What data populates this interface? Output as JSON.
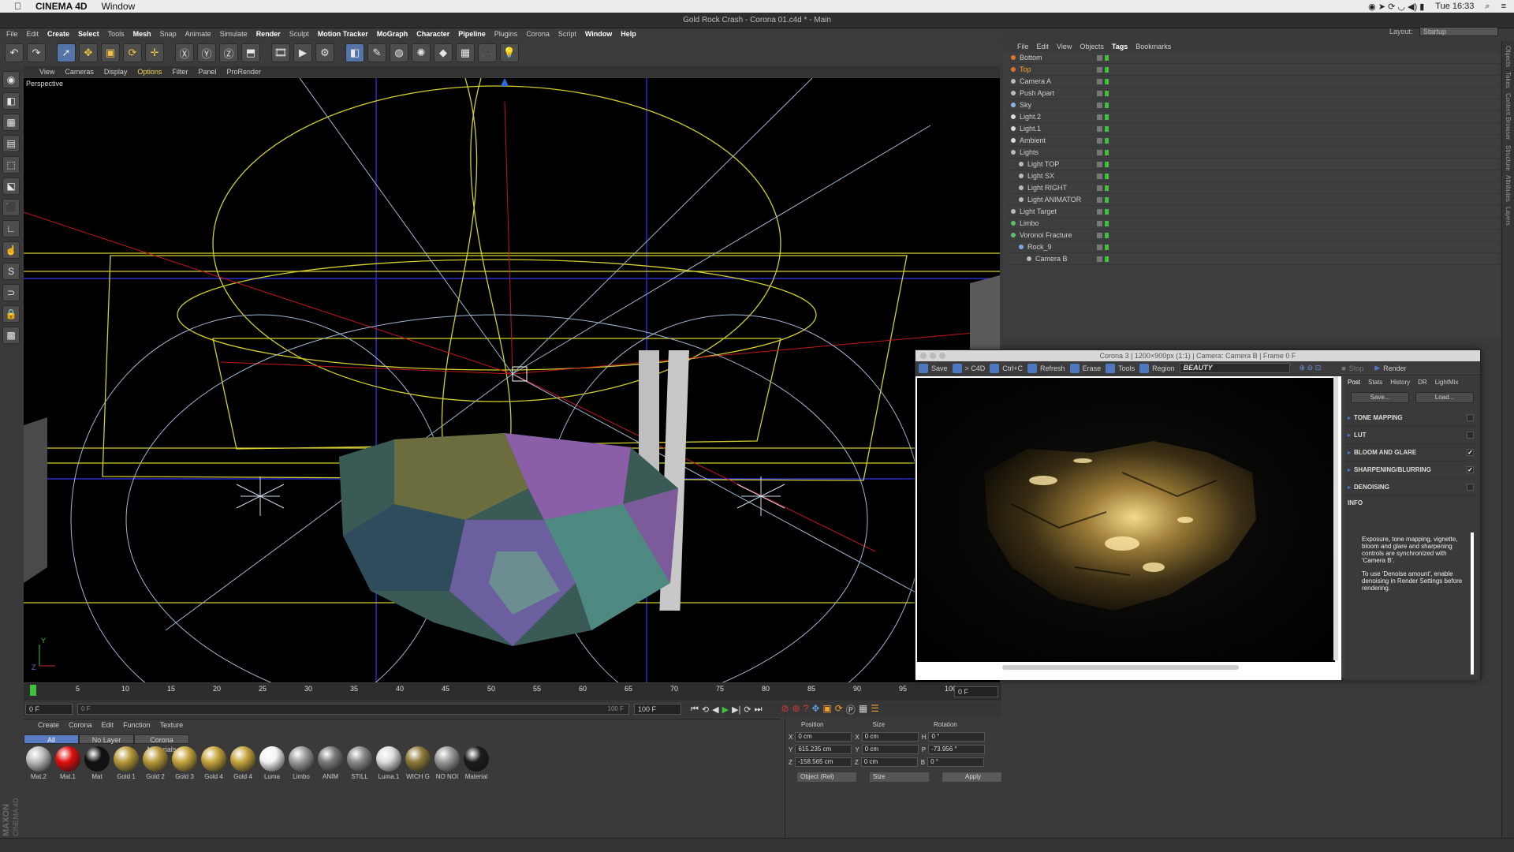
{
  "mac_menubar": {
    "app_name": "CINEMA 4D",
    "window_menu": "Window",
    "time": "Tue 16:33"
  },
  "window_title": "Gold Rock Crash - Corona 01.c4d * - Main",
  "main_menu": [
    "File",
    "Edit",
    "Create",
    "Select",
    "Tools",
    "Mesh",
    "Snap",
    "Animate",
    "Simulate",
    "Render",
    "Sculpt",
    "Motion Tracker",
    "MoGraph",
    "Character",
    "Pipeline",
    "Plugins",
    "Corona",
    "Script",
    "Window",
    "Help"
  ],
  "main_menu_highlight": [
    "Create",
    "Select",
    "Mesh",
    "Render",
    "Motion Tracker",
    "MoGraph",
    "Character",
    "Pipeline",
    "Window",
    "Help"
  ],
  "layout": {
    "label": "Layout:",
    "value": "Startup"
  },
  "viewport": {
    "menu": [
      "View",
      "Cameras",
      "Display",
      "Options",
      "Filter",
      "Panel",
      "ProRender"
    ],
    "active_menu": "Options",
    "label": "Perspective"
  },
  "timeline": {
    "ticks": [
      "0",
      "5",
      "10",
      "15",
      "20",
      "25",
      "30",
      "35",
      "40",
      "45",
      "50",
      "55",
      "60",
      "65",
      "70",
      "75",
      "80",
      "85",
      "90",
      "95",
      "100"
    ],
    "current_frame": "0 F",
    "start": "0 F",
    "slider_start": "0 F",
    "slider_end": "100 F",
    "end": "100 F"
  },
  "materials": {
    "menu": [
      "Create",
      "Corona",
      "Edit",
      "Function",
      "Texture"
    ],
    "tabs": [
      "All",
      "No Layer",
      "Corona Materials"
    ],
    "items": [
      {
        "name": "Mat.2",
        "color": "#bdbdbd"
      },
      {
        "name": "Mat.1",
        "color": "#e01010"
      },
      {
        "name": "Mat",
        "color": "#111111"
      },
      {
        "name": "Gold 1",
        "color": "#b89a3a"
      },
      {
        "name": "Gold 2",
        "color": "#b89a3a"
      },
      {
        "name": "Gold 3",
        "color": "#c7a53d"
      },
      {
        "name": "Gold 4",
        "color": "#c7a53d"
      },
      {
        "name": "Gold 4",
        "color": "#c7a53d"
      },
      {
        "name": "Luma",
        "color": "#f4f4f4"
      },
      {
        "name": "Limbo",
        "color": "#9c9c9c"
      },
      {
        "name": "ANIM",
        "color": "#7a7a7a"
      },
      {
        "name": "STILL",
        "color": "#8a8a8a"
      },
      {
        "name": "Luma.1",
        "color": "#dddddd"
      },
      {
        "name": "WICH G",
        "color": "#8e7a3a"
      },
      {
        "name": "NO NOI",
        "color": "#9a9a9a"
      },
      {
        "name": "Material",
        "color": "#1c1c1c"
      }
    ]
  },
  "coordinates": {
    "headers": [
      "Position",
      "Size",
      "Rotation"
    ],
    "rows": [
      {
        "axis": "X",
        "pos": "0 cm",
        "saxis": "X",
        "size": "0 cm",
        "raxis": "H",
        "rot": "0 °"
      },
      {
        "axis": "Y",
        "pos": "615.235 cm",
        "saxis": "Y",
        "size": "0 cm",
        "raxis": "P",
        "rot": "-73.956 °"
      },
      {
        "axis": "Z",
        "pos": "-158.565 cm",
        "saxis": "Z",
        "size": "0 cm",
        "raxis": "B",
        "rot": "0 °"
      }
    ],
    "mode": "Object (Rel)",
    "size_mode": "Size",
    "apply": "Apply"
  },
  "object_manager": {
    "menu": [
      "File",
      "Edit",
      "View",
      "Objects",
      "Tags",
      "Bookmarks"
    ],
    "active_menu": "Tags",
    "objects": [
      {
        "name": "Bottom",
        "indent": 0,
        "color": "#e0762b",
        "name_color": "#cfcfcf"
      },
      {
        "name": "Top",
        "indent": 0,
        "color": "#e0762b",
        "name_color": "#f0a030"
      },
      {
        "name": "Camera A",
        "indent": 0,
        "color": "#bbbbbb",
        "name_color": "#cfcfcf"
      },
      {
        "name": "Push Apart",
        "indent": 0,
        "color": "#bbbbbb",
        "name_color": "#cfcfcf"
      },
      {
        "name": "Sky",
        "indent": 0,
        "color": "#8fb4e0",
        "name_color": "#cfcfcf"
      },
      {
        "name": "Light.2",
        "indent": 0,
        "color": "#dddddd",
        "name_color": "#cfcfcf"
      },
      {
        "name": "Light.1",
        "indent": 0,
        "color": "#dddddd",
        "name_color": "#cfcfcf"
      },
      {
        "name": "Ambient",
        "indent": 0,
        "color": "#dddddd",
        "name_color": "#cfcfcf"
      },
      {
        "name": "Lights",
        "indent": 0,
        "color": "#bbbbbb",
        "name_color": "#cfcfcf"
      },
      {
        "name": "Light TOP",
        "indent": 1,
        "color": "#bbbbbb",
        "name_color": "#cfcfcf"
      },
      {
        "name": "Light SX",
        "indent": 1,
        "color": "#bbbbbb",
        "name_color": "#cfcfcf"
      },
      {
        "name": "Light RIGHT",
        "indent": 1,
        "color": "#bbbbbb",
        "name_color": "#cfcfcf"
      },
      {
        "name": "Light ANIMATOR",
        "indent": 1,
        "color": "#bbbbbb",
        "name_color": "#cfcfcf"
      },
      {
        "name": "Light Target",
        "indent": 0,
        "color": "#bbbbbb",
        "name_color": "#cfcfcf"
      },
      {
        "name": "Limbo",
        "indent": 0,
        "color": "#5ec06a",
        "name_color": "#cfcfcf"
      },
      {
        "name": "Voronoi Fracture",
        "indent": 0,
        "color": "#5ec06a",
        "name_color": "#cfcfcf"
      },
      {
        "name": "Rock_9",
        "indent": 1,
        "color": "#7fa8e0",
        "name_color": "#cfcfcf"
      },
      {
        "name": "Camera B",
        "indent": 2,
        "color": "#bbbbbb",
        "name_color": "#cfcfcf"
      }
    ]
  },
  "side_tabs": [
    "Objects",
    "Takes",
    "Content Browser",
    "Structure",
    "Attributes",
    "Layers"
  ],
  "corona_vfb": {
    "title": "Corona 3 | 1200×900px (1:1) | Camera: Camera B | Frame 0 F",
    "toolbar": [
      "Save",
      "> C4D",
      "Ctrl+C",
      "Refresh",
      "Erase",
      "Tools",
      "Region"
    ],
    "pass": "BEAUTY",
    "stop": "Stop",
    "render": "Render",
    "tabs": [
      "Post",
      "Stats",
      "History",
      "DR",
      "LightMix"
    ],
    "active_tab": "Post",
    "save_btn": "Save...",
    "load_btn": "Load...",
    "sections": [
      {
        "label": "TONE MAPPING",
        "checked": ""
      },
      {
        "label": "LUT",
        "checked": ""
      },
      {
        "label": "BLOOM AND GLARE",
        "checked": "✓"
      },
      {
        "label": "SHARPENING/BLURRING",
        "checked": "✓"
      },
      {
        "label": "DENOISING",
        "checked": ""
      }
    ],
    "info_title": "INFO",
    "info_text_1": "Exposure, tone mapping, vignette, bloom and glare and sharpening controls are synchronized with 'Camera B'.",
    "info_text_2": "To use 'Denoise amount', enable denoising in Render Settings before rendering."
  },
  "logo": {
    "maxon": "MAXON",
    "cinema": "CINEMA 4D"
  }
}
